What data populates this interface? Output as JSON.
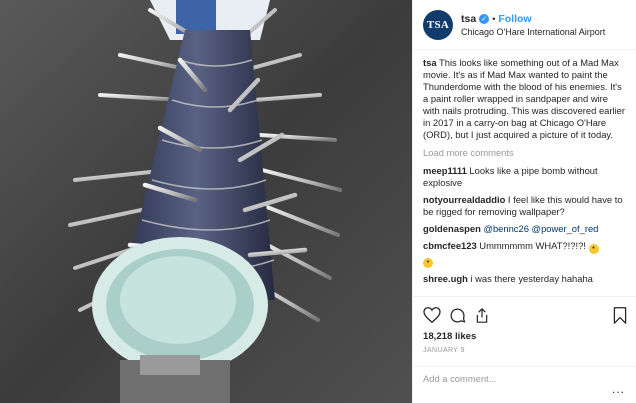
{
  "post": {
    "avatar_text": "TSA",
    "username": "tsa",
    "separator": "•",
    "follow_label": "Follow",
    "location": "Chicago O'Hare International Airport",
    "caption": "This looks like something out of a Mad Max movie. It's as if Mad Max wanted to paint the Thunderdome with the blood of his enemies. It's a paint roller wrapped in sandpaper and wire with nails protruding. This was discovered earlier in 2017 in a carry-on bag at Chicago O'Hare (ORD), but I just acquired a picture of it today.",
    "load_more": "Load more comments",
    "comments": [
      {
        "user": "meep1111",
        "text": "Looks like a pipe bomb without explosive"
      },
      {
        "user": "notyourrealdaddio",
        "text": "I feel like this would have to be rigged for removing wallpaper?"
      },
      {
        "user": "goldenaspen",
        "mention1": "@bennc26",
        "mention2": "@power_of_red"
      },
      {
        "user": "cbmcfee123",
        "text": "Ummmmmm WHAT?!?!?!"
      },
      {
        "user": "shree.ugh",
        "text": "i was there yesterday hahaha"
      }
    ],
    "likes": "18,218 likes",
    "date": "JANUARY 9",
    "add_comment_placeholder": "Add a comment...",
    "more_label": "..."
  },
  "icons": {
    "like": "heart-icon",
    "comment": "comment-bubble-icon",
    "share": "share-icon",
    "save": "bookmark-icon",
    "verified": "verified-badge-icon"
  },
  "colors": {
    "link": "#3897f0",
    "mention": "#003569",
    "avatar_bg": "#123b6d",
    "muted": "#999999"
  }
}
